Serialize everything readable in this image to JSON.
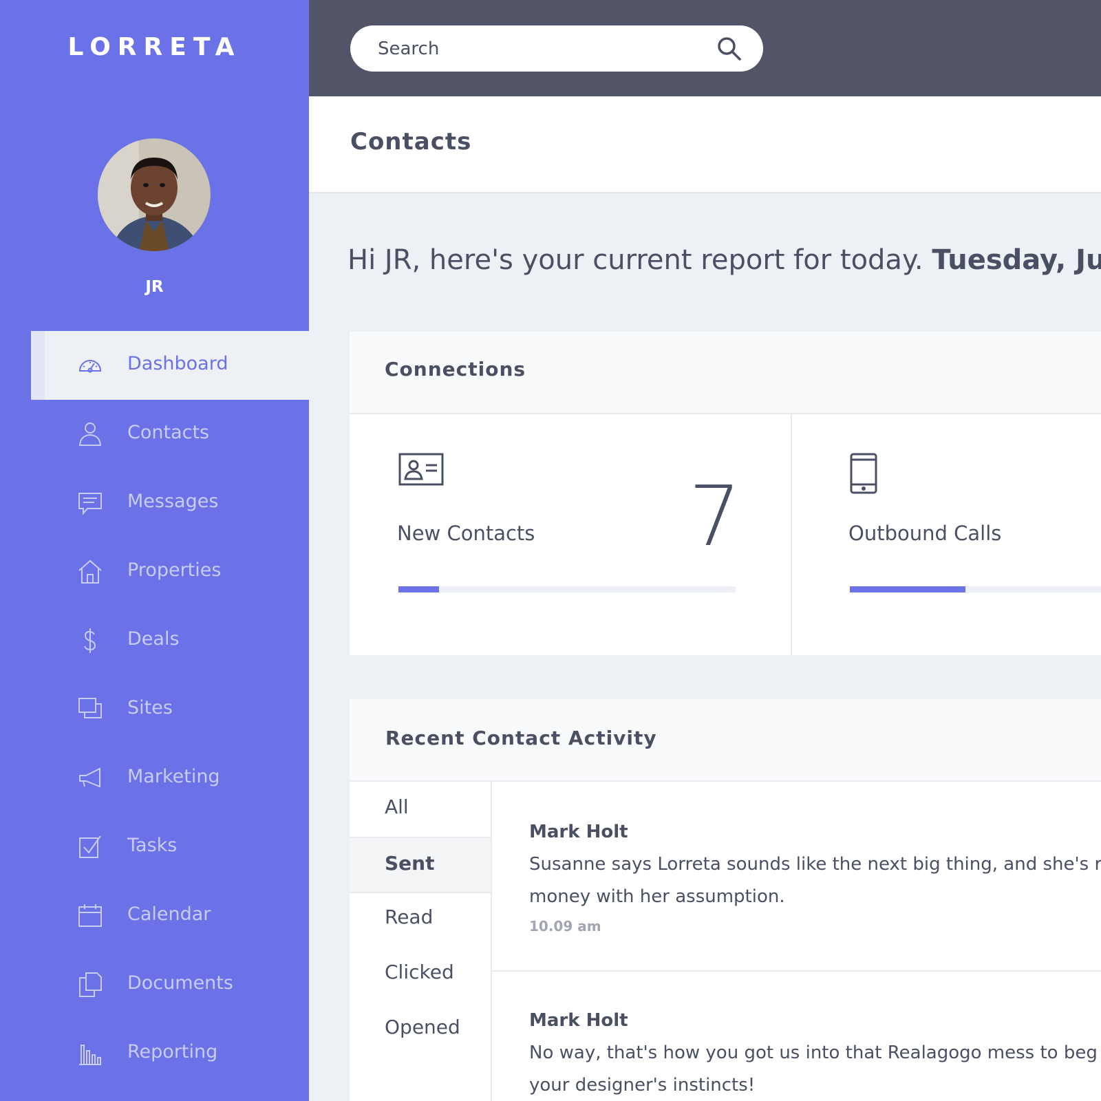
{
  "app": {
    "brand": "LORRETA"
  },
  "user": {
    "name": "JR"
  },
  "nav": [
    {
      "label": "Dashboard",
      "icon": "dashboard-gauge-icon",
      "active": true
    },
    {
      "label": "Contacts",
      "icon": "user-icon"
    },
    {
      "label": "Messages",
      "icon": "chat-icon"
    },
    {
      "label": "Properties",
      "icon": "house-icon"
    },
    {
      "label": "Deals",
      "icon": "dollar-icon"
    },
    {
      "label": "Sites",
      "icon": "windows-icon"
    },
    {
      "label": "Marketing",
      "icon": "megaphone-icon"
    },
    {
      "label": "Tasks",
      "icon": "checkbox-icon"
    },
    {
      "label": "Calendar",
      "icon": "calendar-icon"
    },
    {
      "label": "Documents",
      "icon": "documents-icon"
    },
    {
      "label": "Reporting",
      "icon": "bar-chart-icon"
    }
  ],
  "search": {
    "placeholder": "Search",
    "icon": "search-icon"
  },
  "page": {
    "title": "Contacts",
    "greeting": "Hi JR, here's your current report for today.",
    "date": "Tuesday, June"
  },
  "connections": {
    "title": "Connections",
    "stats": [
      {
        "label": "New Contacts",
        "value": "7",
        "icon": "contact-card-icon",
        "progress": 0.12
      },
      {
        "label": "Outbound Calls",
        "value": "",
        "icon": "phone-icon",
        "progress": 0.42
      }
    ]
  },
  "activity": {
    "title": "Recent Contact Activity",
    "tabs": [
      "All",
      "Sent",
      "Read",
      "Clicked",
      "Opened"
    ],
    "active_tab": "Sent",
    "entries": [
      {
        "name": "Mark Holt",
        "line1": "Susanne says Lorreta sounds like the next big thing, and she's ri",
        "line2": "money with her assumption.",
        "time": "10.09 am"
      },
      {
        "name": "Mark Holt",
        "line1": "No way, that's how you got us into that Realagogo mess to beg",
        "line2": "your designer's instincts!",
        "time": ""
      }
    ]
  },
  "colors": {
    "accent": "#6b71e6",
    "topbar": "#515567",
    "text": "#4a5063",
    "background": "#edf0f5"
  }
}
